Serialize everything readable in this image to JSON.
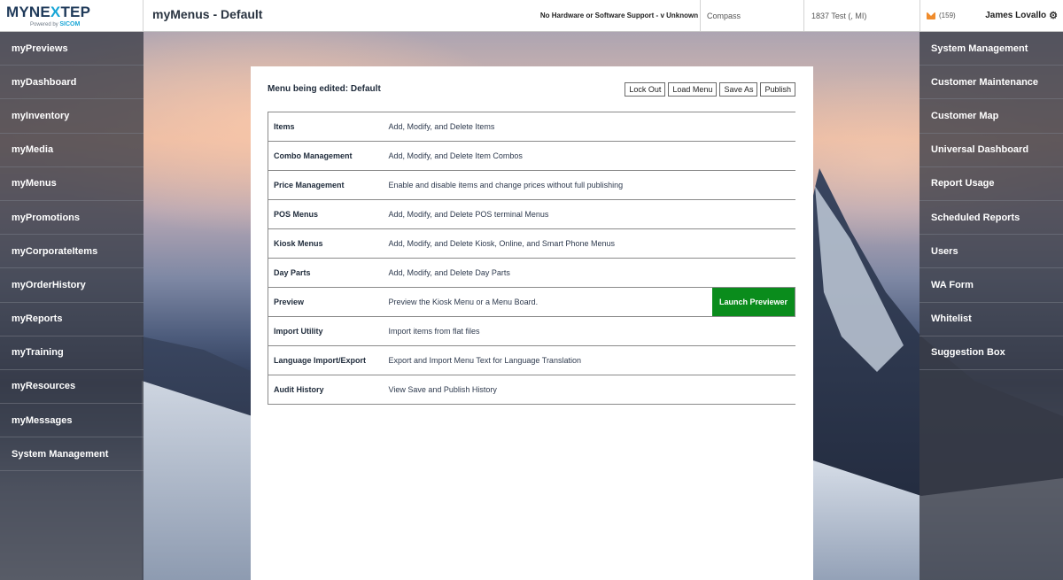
{
  "brand": {
    "logo_prefix": "MYNE",
    "logo_x": "X",
    "logo_suffix": "TEP",
    "powered_by": "Powered by",
    "powered_brand": "SICOM"
  },
  "header": {
    "page_title": "myMenus - Default",
    "support": "No Hardware or Software Support - v Unknown",
    "store": "Compass",
    "location": "1837 Test (, MI)",
    "message_count": "(159)",
    "user_name": "James Lovallo",
    "icons": {
      "mail": "envelope-icon",
      "settings": "gear-icon"
    },
    "mail_color": "#f08c2c"
  },
  "left_nav": [
    "myPreviews",
    "myDashboard",
    "myInventory",
    "myMedia",
    "myMenus",
    "myPromotions",
    "myCorporateItems",
    "myOrderHistory",
    "myReports",
    "myTraining",
    "myResources",
    "myMessages",
    "System Management"
  ],
  "right_nav": [
    "System Management",
    "Customer Maintenance",
    "Customer Map",
    "Universal Dashboard",
    "Report Usage",
    "Scheduled Reports",
    "Users",
    "WA Form",
    "Whitelist",
    "Suggestion Box"
  ],
  "panel": {
    "heading": "Menu being edited: Default",
    "toolbar": [
      "Lock Out",
      "Load Menu",
      "Save As",
      "Publish"
    ],
    "rows": [
      {
        "name": "Items",
        "description": "Add, Modify, and Delete Items"
      },
      {
        "name": "Combo Management",
        "description": "Add, Modify, and Delete Item Combos"
      },
      {
        "name": "Price Management",
        "description": "Enable and disable items and change prices without full publishing"
      },
      {
        "name": "POS Menus",
        "description": "Add, Modify, and Delete POS terminal Menus"
      },
      {
        "name": "Kiosk Menus",
        "description": "Add, Modify, and Delete Kiosk, Online, and Smart Phone Menus"
      },
      {
        "name": "Day Parts",
        "description": "Add, Modify, and Delete Day Parts"
      },
      {
        "name": "Preview",
        "description": "Preview the Kiosk Menu or a Menu Board.",
        "action": "Launch Previewer"
      },
      {
        "name": "Import Utility",
        "description": "Import items from flat files"
      },
      {
        "name": "Language Import/Export",
        "description": "Export and Import Menu Text for Language Translation"
      },
      {
        "name": "Audit History",
        "description": "View Save and Publish History"
      }
    ],
    "action_color": "#0a8c1c"
  }
}
